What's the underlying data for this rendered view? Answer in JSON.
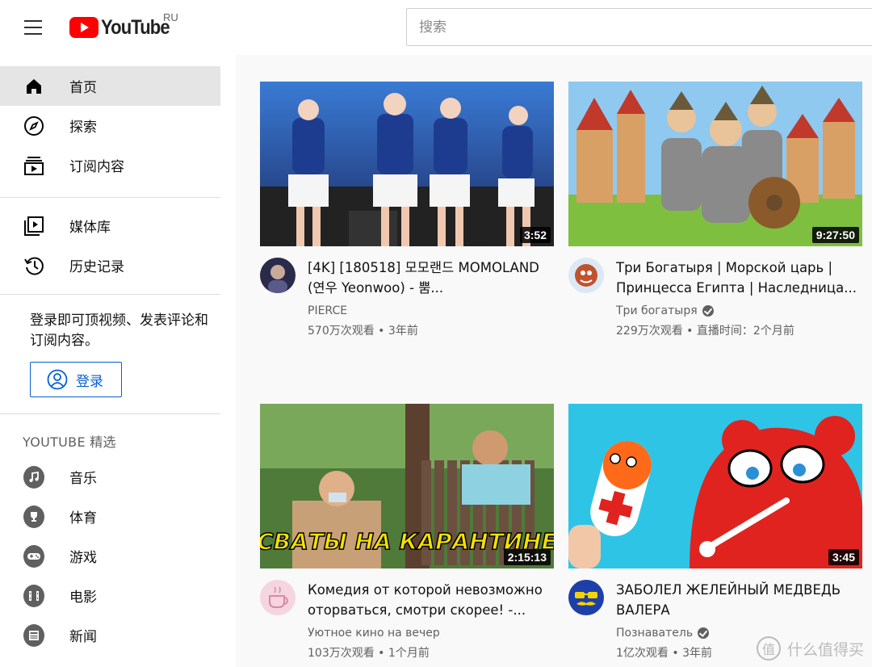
{
  "header": {
    "logo_text": "YouTube",
    "region": "RU",
    "search_placeholder": "搜索",
    "brand_red": "#ff0000"
  },
  "sidebar": {
    "primary": [
      {
        "label": "首页",
        "icon": "home-icon",
        "active": true
      },
      {
        "label": "探索",
        "icon": "compass-icon",
        "active": false
      },
      {
        "label": "订阅内容",
        "icon": "subscriptions-icon",
        "active": false
      }
    ],
    "secondary": [
      {
        "label": "媒体库",
        "icon": "library-icon"
      },
      {
        "label": "历史记录",
        "icon": "history-icon"
      }
    ],
    "signin_prompt": "登录即可顶视频、发表评论和订阅内容。",
    "signin_button": "登录",
    "best_of_title": "YOUTUBE 精选",
    "best_of": [
      {
        "label": "音乐",
        "icon": "music-icon"
      },
      {
        "label": "体育",
        "icon": "trophy-icon"
      },
      {
        "label": "游戏",
        "icon": "gamepad-icon"
      },
      {
        "label": "电影",
        "icon": "film-icon"
      },
      {
        "label": "新闻",
        "icon": "news-icon"
      }
    ]
  },
  "videos": [
    {
      "title": "[4K] [180518] 모모랜드 MOMOLAND (연우 Yeonwoo) - 뿜...",
      "channel": "PIERCE",
      "verified": false,
      "views": "570万次观看",
      "age": "3年前",
      "duration": "3:52"
    },
    {
      "title": "Три Богатыря | Морской царь | Принцесса Египта | Наследница...",
      "channel": "Три богатыря",
      "verified": true,
      "views": "229万次观看",
      "age": "直播时间：2个月前",
      "duration": "9:27:50"
    },
    {
      "title": "Комедия от которой невозможно оторваться, смотри скорее! -...",
      "channel": "Уютное кино на вечер",
      "verified": false,
      "views": "103万次观看",
      "age": "1个月前",
      "duration": "2:15:13",
      "thumb_caption": "СВАТЫ НА КАРАНТИНЕ"
    },
    {
      "title": "ЗАБОЛЕЛ ЖЕЛЕЙНЫЙ МЕДВЕДЬ ВАЛЕРА",
      "channel": "Познаватель",
      "verified": true,
      "views": "1亿次观看",
      "age": "3年前",
      "duration": "3:45"
    }
  ],
  "meta_separator": " • ",
  "watermark": {
    "icon_text": "值",
    "text": "什么值得买"
  }
}
